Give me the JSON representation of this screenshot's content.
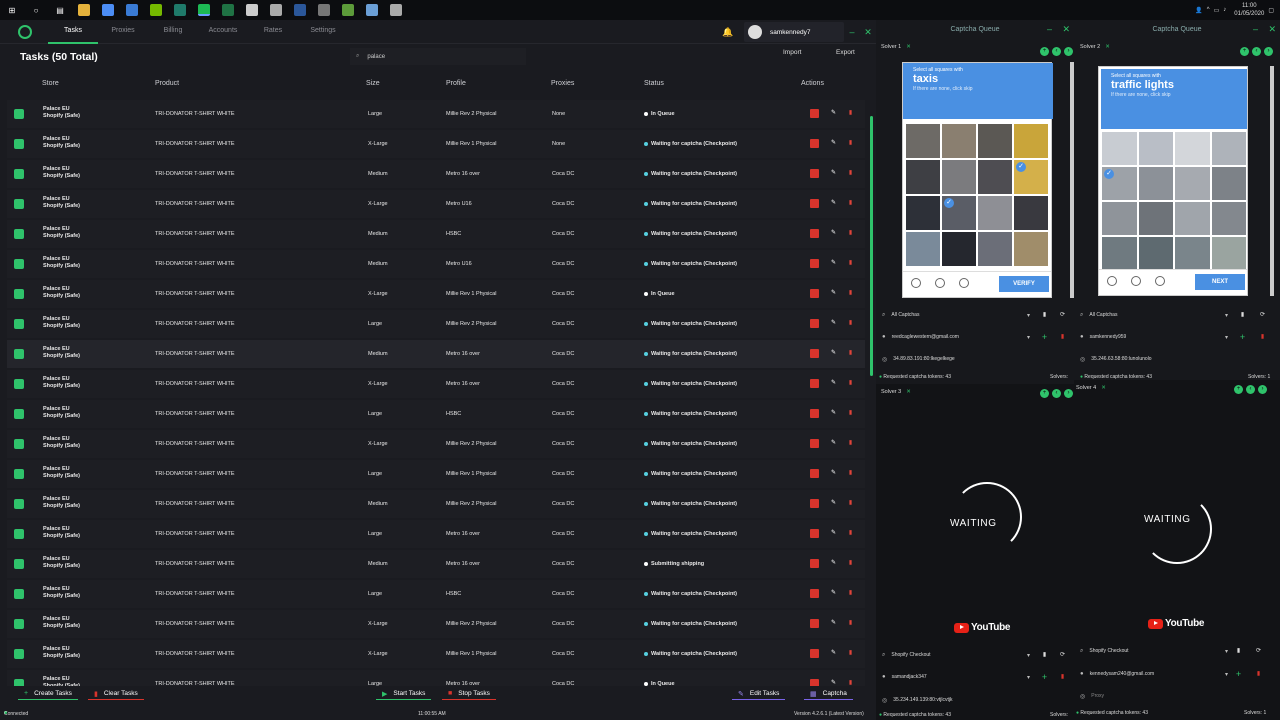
{
  "taskbar": {
    "icons": [
      "windows-icon",
      "search-icon",
      "task-view-icon",
      "file-explorer-icon",
      "chrome-icon",
      "windows-app-icon",
      "nvidia-icon",
      "terminal-icon",
      "spotify-icon",
      "excel-icon",
      "settings-icon",
      "steam-icon",
      "word-icon",
      "epic-games-icon",
      "minecraft-icon",
      "notepad-icon",
      "clock-app-icon"
    ],
    "time": "11:00",
    "date": "01/05/2020"
  },
  "nav": {
    "tabs": [
      "Tasks",
      "Proxies",
      "Billing",
      "Accounts",
      "Rates",
      "Settings"
    ],
    "active": "Tasks",
    "username": "samkennedy7"
  },
  "toolbar": {
    "title": "Tasks (50 Total)",
    "search_value": "palace",
    "import_label": "Import",
    "export_label": "Export"
  },
  "table": {
    "headers": [
      "Store",
      "Product",
      "Size",
      "Profile",
      "Proxies",
      "Status",
      "Actions"
    ],
    "rows": [
      {
        "store": "Palace EU",
        "store2": "Shopify (Safe)",
        "product": "TRI-DONATOR T-SHIRT WHITE",
        "size": "Large",
        "profile": "Millie Rev 2 Physical",
        "proxies": "None",
        "status": "In Queue",
        "type": "q"
      },
      {
        "store": "Palace EU",
        "store2": "Shopify (Safe)",
        "product": "TRI-DONATOR T-SHIRT WHITE",
        "size": "X-Large",
        "profile": "Millie Rev 1  Physical",
        "proxies": "None",
        "status": "Waiting for captcha (Checkpoint)",
        "type": "w"
      },
      {
        "store": "Palace EU",
        "store2": "Shopify (Safe)",
        "product": "TRI-DONATOR T-SHIRT WHITE",
        "size": "Medium",
        "profile": "Metro 16 over",
        "proxies": "Coca DC",
        "status": "Waiting for captcha (Checkpoint)",
        "type": "w"
      },
      {
        "store": "Palace EU",
        "store2": "Shopify (Safe)",
        "product": "TRI-DONATOR T-SHIRT WHITE",
        "size": "X-Large",
        "profile": "Metro U16",
        "proxies": "Coca DC",
        "status": "Waiting for captcha (Checkpoint)",
        "type": "w"
      },
      {
        "store": "Palace EU",
        "store2": "Shopify (Safe)",
        "product": "TRI-DONATOR T-SHIRT WHITE",
        "size": "Medium",
        "profile": "HSBC",
        "proxies": "Coca DC",
        "status": "Waiting for captcha (Checkpoint)",
        "type": "w"
      },
      {
        "store": "Palace EU",
        "store2": "Shopify (Safe)",
        "product": "TRI-DONATOR T-SHIRT WHITE",
        "size": "Medium",
        "profile": "Metro U16",
        "proxies": "Coca DC",
        "status": "Waiting for captcha (Checkpoint)",
        "type": "w"
      },
      {
        "store": "Palace EU",
        "store2": "Shopify (Safe)",
        "product": "TRI-DONATOR T-SHIRT WHITE",
        "size": "X-Large",
        "profile": "Millie Rev 1  Physical",
        "proxies": "Coca DC",
        "status": "In Queue",
        "type": "q"
      },
      {
        "store": "Palace EU",
        "store2": "Shopify (Safe)",
        "product": "TRI-DONATOR T-SHIRT WHITE",
        "size": "Large",
        "profile": "Millie Rev 2 Physical",
        "proxies": "Coca DC",
        "status": "Waiting for captcha (Checkpoint)",
        "type": "w"
      },
      {
        "store": "Palace EU",
        "store2": "Shopify (Safe)",
        "product": "TRI-DONATOR T-SHIRT WHITE",
        "size": "Medium",
        "profile": "Metro 16 over",
        "proxies": "Coca DC",
        "status": "Waiting for captcha (Checkpoint)",
        "type": "w"
      },
      {
        "store": "Palace EU",
        "store2": "Shopify (Safe)",
        "product": "TRI-DONATOR T-SHIRT WHITE",
        "size": "X-Large",
        "profile": "Metro 16 over",
        "proxies": "Coca DC",
        "status": "Waiting for captcha (Checkpoint)",
        "type": "w"
      },
      {
        "store": "Palace EU",
        "store2": "Shopify (Safe)",
        "product": "TRI-DONATOR T-SHIRT WHITE",
        "size": "Large",
        "profile": "HSBC",
        "proxies": "Coca DC",
        "status": "Waiting for captcha (Checkpoint)",
        "type": "w"
      },
      {
        "store": "Palace EU",
        "store2": "Shopify (Safe)",
        "product": "TRI-DONATOR T-SHIRT WHITE",
        "size": "X-Large",
        "profile": "Millie Rev 2 Physical",
        "proxies": "Coca DC",
        "status": "Waiting for captcha (Checkpoint)",
        "type": "w"
      },
      {
        "store": "Palace EU",
        "store2": "Shopify (Safe)",
        "product": "TRI-DONATOR T-SHIRT WHITE",
        "size": "Large",
        "profile": "Millie Rev 1  Physical",
        "proxies": "Coca DC",
        "status": "Waiting for captcha (Checkpoint)",
        "type": "w"
      },
      {
        "store": "Palace EU",
        "store2": "Shopify (Safe)",
        "product": "TRI-DONATOR T-SHIRT WHITE",
        "size": "Medium",
        "profile": "Millie Rev 2 Physical",
        "proxies": "Coca DC",
        "status": "Waiting for captcha (Checkpoint)",
        "type": "w"
      },
      {
        "store": "Palace EU",
        "store2": "Shopify (Safe)",
        "product": "TRI-DONATOR T-SHIRT WHITE",
        "size": "Large",
        "profile": "Metro 16 over",
        "proxies": "Coca DC",
        "status": "Waiting for captcha (Checkpoint)",
        "type": "w"
      },
      {
        "store": "Palace EU",
        "store2": "Shopify (Safe)",
        "product": "TRI-DONATOR T-SHIRT WHITE",
        "size": "Medium",
        "profile": "Metro 16 over",
        "proxies": "Coca DC",
        "status": "Submitting shipping",
        "type": "q"
      },
      {
        "store": "Palace EU",
        "store2": "Shopify (Safe)",
        "product": "TRI-DONATOR T-SHIRT WHITE",
        "size": "Large",
        "profile": "HSBC",
        "proxies": "Coca DC",
        "status": "Waiting for captcha (Checkpoint)",
        "type": "w"
      },
      {
        "store": "Palace EU",
        "store2": "Shopify (Safe)",
        "product": "TRI-DONATOR T-SHIRT WHITE",
        "size": "X-Large",
        "profile": "Millie Rev 2 Physical",
        "proxies": "Coca DC",
        "status": "Waiting for captcha (Checkpoint)",
        "type": "w"
      },
      {
        "store": "Palace EU",
        "store2": "Shopify (Safe)",
        "product": "TRI-DONATOR T-SHIRT WHITE",
        "size": "X-Large",
        "profile": "Millie Rev 1  Physical",
        "proxies": "Coca DC",
        "status": "Waiting for captcha (Checkpoint)",
        "type": "w"
      },
      {
        "store": "Palace EU",
        "store2": "Shopify (Safe)",
        "product": "TRI-DONATOR T-SHIRT WHITE",
        "size": "Large",
        "profile": "Metro 16 over",
        "proxies": "Coca DC",
        "status": "In Queue",
        "type": "q"
      }
    ]
  },
  "footer": {
    "create_tasks": "Create Tasks",
    "clear_tasks": "Clear Tasks",
    "start_tasks": "Start Tasks",
    "stop_tasks": "Stop Tasks",
    "edit_tasks": "Edit Tasks",
    "captcha": "Captcha",
    "connected": "Connected",
    "time": "11:00:55 AM",
    "version": "Version 4.2.6.1 (Latest Version)"
  },
  "captcha_queue": {
    "title": "Captcha Queue",
    "solvers": [
      {
        "tab": "Solver 1",
        "prompt": "Select all squares with",
        "target": "taxis",
        "hint": "If there are none, click skip",
        "button": "VERIFY",
        "filter": "All Captchas",
        "account": "reedcaglewestern@gmail.com",
        "proxy": "34.89.83.191:80:lkegelkege",
        "tokens": "Requested captcha tokens: 43",
        "solvers": "Solvers:"
      },
      {
        "tab": "Solver 2",
        "prompt": "Select all squares with",
        "target": "traffic lights",
        "hint": "If there are none, click skip",
        "button": "NEXT",
        "filter": "All Captchas",
        "account": "samkennedy959",
        "proxy": "35.246.63.58:80:lunolunolo",
        "tokens": "Requested captcha tokens: 43",
        "solvers": "Solvers: 1"
      },
      {
        "tab": "Solver 3",
        "waiting": "WAITING",
        "brand": "YouTube",
        "filter": "Shopify Checkout",
        "account": "samandjack347",
        "proxy": "35.234.149.139:80:vtjlcvtjk",
        "tokens": "Requested captcha tokens: 43",
        "solvers": "Solvers:"
      },
      {
        "tab": "Solver 4",
        "waiting": "WAITING",
        "brand": "YouTube",
        "filter": "Shopify Checkout",
        "account": "kennedysam240@gmail.com",
        "proxy": "Proxy",
        "tokens": "Requested captcha tokens: 43",
        "solvers": "Solvers: 1"
      }
    ]
  }
}
